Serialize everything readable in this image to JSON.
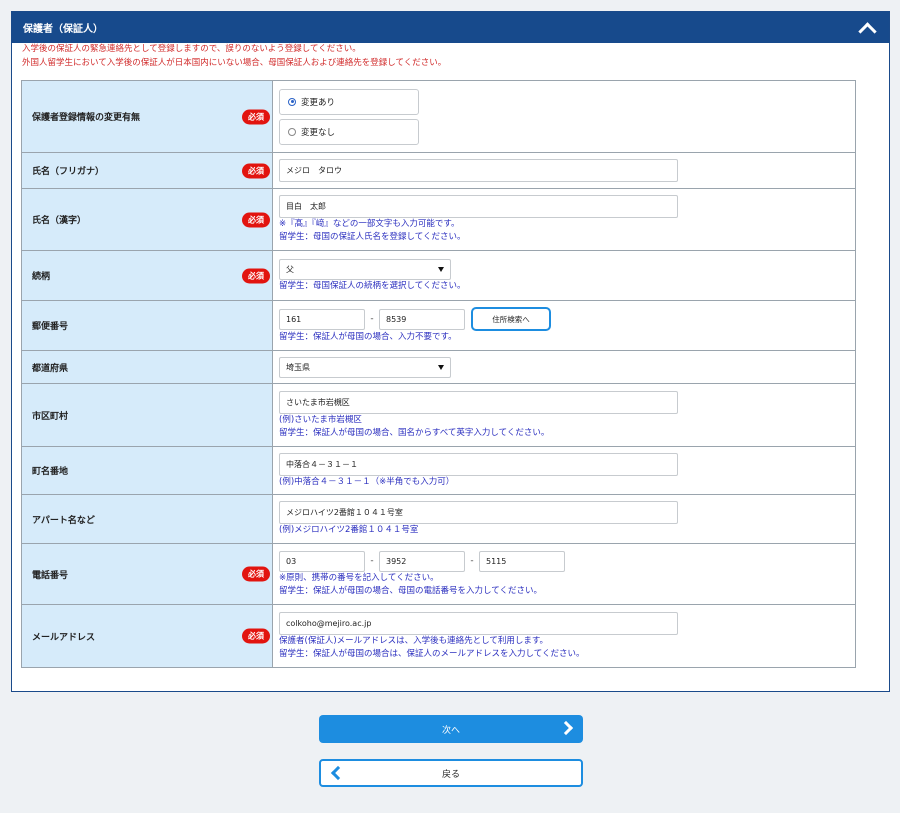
{
  "panel": {
    "title": "保護者（保証人）",
    "notice_line1": "入学後の保証人の緊急連絡先として登録しますので、誤りのないよう登録してください。",
    "notice_line2": "外国人留学生において入学後の保証人が日本国内にいない場合、母国保証人および連絡先を登録してください。"
  },
  "required_label": "必須",
  "rows": {
    "change": {
      "label": "保護者登録情報の変更有無",
      "option1": "変更あり",
      "option2": "変更なし",
      "selected": "変更あり"
    },
    "kana": {
      "label": "氏名（フリガナ）",
      "value": "メジロ　タロウ"
    },
    "kanji": {
      "label": "氏名（漢字）",
      "value": "目白　太郎",
      "note1": "※『髙』『﨑』などの一部文字も入力可能です。",
      "note2": "留学生：母国の保証人氏名を登録してください。"
    },
    "relation": {
      "label": "続柄",
      "value": "父",
      "note1": "留学生：母国保証人の続柄を選択してください。"
    },
    "postal": {
      "label": "郵便番号",
      "value1": "161",
      "value2": "8539",
      "dash": "-",
      "button": "住所検索へ",
      "note1": "留学生：保証人が母国の場合、入力不要です。"
    },
    "pref": {
      "label": "都道府県",
      "value": "埼玉県"
    },
    "city": {
      "label": "市区町村",
      "value": "さいたま市岩槻区",
      "note1": "(例)さいたま市岩槻区",
      "note2": "留学生：保証人が母国の場合、国名からすべて英字入力してください。"
    },
    "town": {
      "label": "町名番地",
      "value": "中落合４－３１－１",
      "note1": "(例)中落合４－３１－１（※半角でも入力可）"
    },
    "apt": {
      "label": "アパート名など",
      "value": "メジロハイツ2番館１０４１号室",
      "note1": "(例)メジロハイツ2番館１０４１号室"
    },
    "phone": {
      "label": "電話番号",
      "value1": "03",
      "value2": "3952",
      "value3": "5115",
      "dash": "-",
      "note1": "※原則、携帯の番号を記入してください。",
      "note2": "留学生：保証人が母国の場合、母国の電話番号を入力してください。"
    },
    "email": {
      "label": "メールアドレス",
      "value": "colkoho@mejiro.ac.jp",
      "note1": "保護者(保証人)メールアドレスは、入学後も連絡先として利用します。",
      "note2": "留学生：保証人が母国の場合は、保証人のメールアドレスを入力してください。"
    }
  },
  "buttons": {
    "next": "次へ",
    "back": "戻る"
  },
  "colors": {
    "header": "#174a8c",
    "label_bg": "#d6ebfa",
    "required": "#e2140f",
    "note": "#2b2fbf",
    "button": "#1d8de0"
  }
}
